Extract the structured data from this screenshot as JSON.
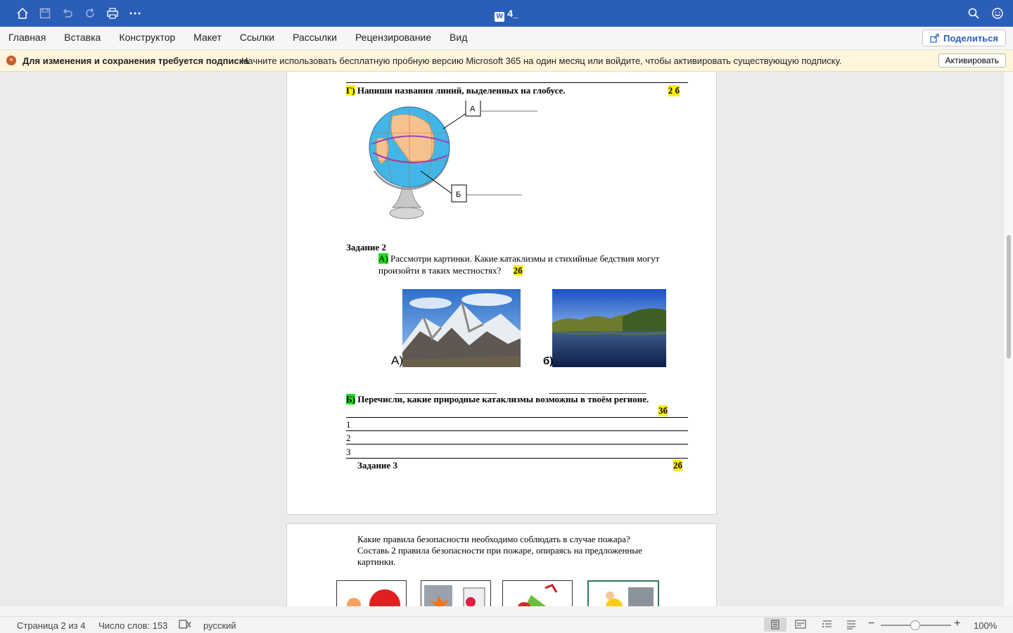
{
  "window": {
    "title": "4_"
  },
  "ribbon": {
    "tabs": [
      "Главная",
      "Вставка",
      "Конструктор",
      "Макет",
      "Ссылки",
      "Рассылки",
      "Рецензирование",
      "Вид"
    ],
    "share_label": "Поделиться"
  },
  "notification": {
    "bold": "Для изменения и сохранения требуется подписка",
    "message": "Начните использовать бесплатную пробную версию Microsoft 365 на один месяц или войдите, чтобы активировать существующую подписку.",
    "button": "Активировать"
  },
  "doc": {
    "g_label": "Г)",
    "g_text": "Напиши названия линий, выделенных на глобусе.",
    "g_points": "2 б",
    "globe_label_a": "А",
    "globe_label_b": "Б",
    "task2_title": "Задание 2",
    "a_label": "А)",
    "a_text": "Рассмотри картинки. Какие катаклизмы и стихийные бедствия могут произойти в таких местностях?",
    "a_points": "2б",
    "img_label_a": "А)",
    "img_label_b": "б)",
    "b_label": "Б)",
    "b_text": "Перечисли, какие природные  катаклизмы возможны в твоём регионе.",
    "b_points": "3б",
    "rows": [
      "1",
      "2",
      "3"
    ],
    "task3_title": "Задание 3",
    "task3_points": "2б",
    "fire_q1": "Какие правила безопасности необходимо соблюдать в случае пожара?",
    "fire_q2": "Составь 2 правила безопасности при пожаре, опираясь на предложенные картинки."
  },
  "status": {
    "page": "Страница 2 из 4",
    "words": "Число слов: 153",
    "language": "русский",
    "zoom": "100%"
  }
}
